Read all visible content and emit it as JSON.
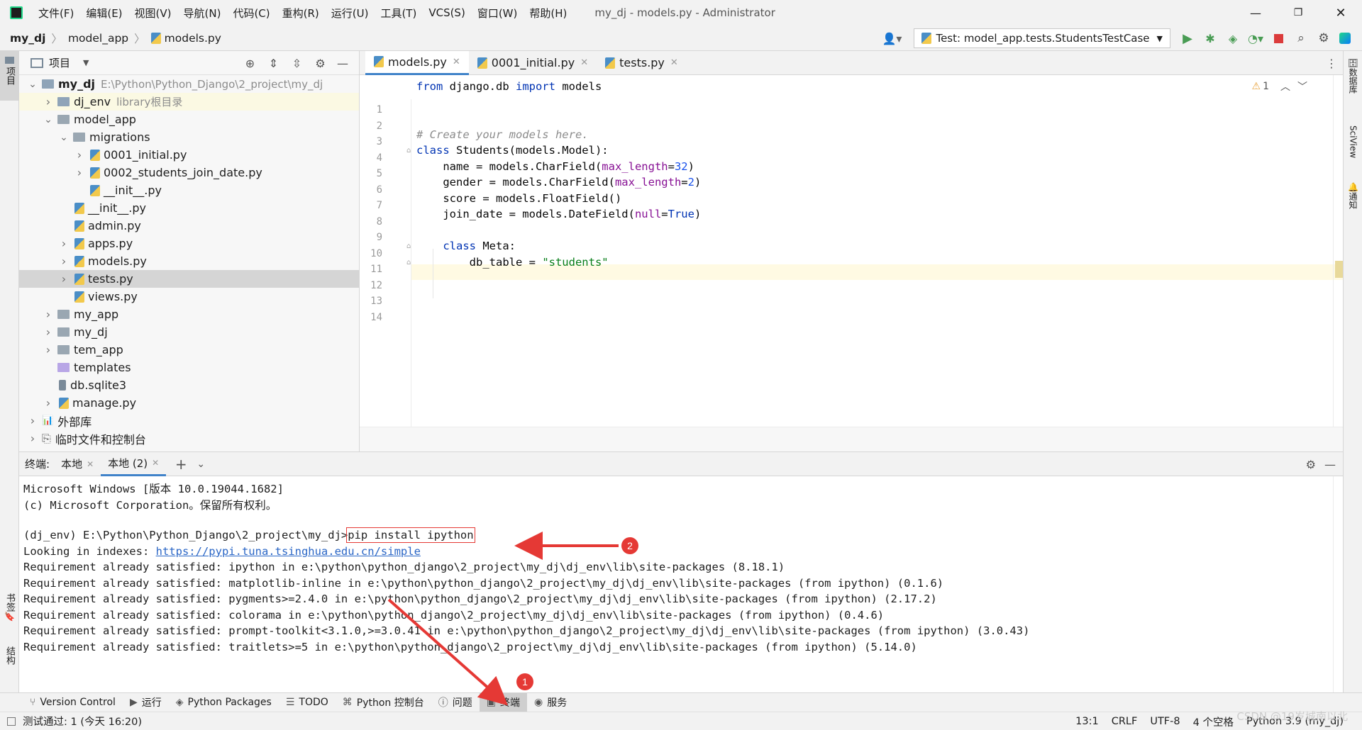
{
  "app": {
    "window_title": "my_dj - models.py - Administrator",
    "menu": [
      "文件(F)",
      "编辑(E)",
      "视图(V)",
      "导航(N)",
      "代码(C)",
      "重构(R)",
      "运行(U)",
      "工具(T)",
      "VCS(S)",
      "窗口(W)",
      "帮助(H)"
    ]
  },
  "breadcrumb": [
    "my_dj",
    "model_app",
    "models.py"
  ],
  "run_config": "Test: model_app.tests.StudentsTestCase",
  "project_panel": {
    "title": "项目",
    "tree": [
      {
        "name": "my_dj",
        "extra": "E:\\Python\\Python_Django\\2_project\\my_dj",
        "kind": "folder",
        "depth": 0,
        "open": true,
        "bold": true
      },
      {
        "name": "dj_env",
        "extra": "library根目录",
        "kind": "folder",
        "depth": 1,
        "open": false
      },
      {
        "name": "model_app",
        "extra": "",
        "kind": "pkg",
        "depth": 1,
        "open": true
      },
      {
        "name": "migrations",
        "extra": "",
        "kind": "pkg",
        "depth": 2,
        "open": true
      },
      {
        "name": "0001_initial.py",
        "extra": "",
        "kind": "py",
        "depth": 3,
        "open": false
      },
      {
        "name": "0002_students_join_date.py",
        "extra": "",
        "kind": "py",
        "depth": 3,
        "open": false
      },
      {
        "name": "__init__.py",
        "extra": "",
        "kind": "py",
        "depth": 3,
        "leaf": true
      },
      {
        "name": "__init__.py",
        "extra": "",
        "kind": "py",
        "depth": 2,
        "leaf": true
      },
      {
        "name": "admin.py",
        "extra": "",
        "kind": "py",
        "depth": 2,
        "leaf": true
      },
      {
        "name": "apps.py",
        "extra": "",
        "kind": "py",
        "depth": 2,
        "open": false
      },
      {
        "name": "models.py",
        "extra": "",
        "kind": "py",
        "depth": 2,
        "open": false
      },
      {
        "name": "tests.py",
        "extra": "",
        "kind": "py",
        "depth": 2,
        "open": false,
        "selected": true
      },
      {
        "name": "views.py",
        "extra": "",
        "kind": "py",
        "depth": 2,
        "leaf": true
      },
      {
        "name": "my_app",
        "extra": "",
        "kind": "pkg",
        "depth": 1,
        "open": false
      },
      {
        "name": "my_dj",
        "extra": "",
        "kind": "pkg",
        "depth": 1,
        "open": false
      },
      {
        "name": "tem_app",
        "extra": "",
        "kind": "pkg",
        "depth": 1,
        "open": false
      },
      {
        "name": "templates",
        "extra": "",
        "kind": "tpl",
        "depth": 1,
        "leaf": true
      },
      {
        "name": "db.sqlite3",
        "extra": "",
        "kind": "db",
        "depth": 1,
        "leaf": true
      },
      {
        "name": "manage.py",
        "extra": "",
        "kind": "py",
        "depth": 1,
        "open": false
      },
      {
        "name": "外部库",
        "extra": "",
        "kind": "lib",
        "depth": 0,
        "open": false
      },
      {
        "name": "临时文件和控制台",
        "extra": "",
        "kind": "scratch",
        "depth": 0,
        "open": false
      }
    ]
  },
  "editor": {
    "tabs": [
      {
        "label": "models.py",
        "active": true
      },
      {
        "label": "0001_initial.py",
        "active": false
      },
      {
        "label": "tests.py",
        "active": false
      }
    ],
    "warning_count": "1",
    "lines": [
      "1",
      "2",
      "3",
      "4",
      "5",
      "6",
      "7",
      "8",
      "9",
      "10",
      "11",
      "12",
      "13",
      "14"
    ],
    "code": {
      "l1_kw1": "from",
      "l1_mod": " django.db ",
      "l1_kw2": "import",
      "l1_name": " models",
      "l4_comment": "# Create your models here.",
      "l5_kw": "class",
      "l5_rest": " Students(models.Model):",
      "l6_a": "    name = models.CharField(",
      "l6_p": "max_length",
      "l6_eq": "=",
      "l6_n": "32",
      "l6_c": ")",
      "l7_a": "    gender = models.CharField(",
      "l7_p": "max_length",
      "l7_eq": "=",
      "l7_n": "2",
      "l7_c": ")",
      "l8": "    score = models.FloatField()",
      "l9_a": "    join_date = models.DateField(",
      "l9_p": "null",
      "l9_eq": "=",
      "l9_v": "True",
      "l9_c": ")",
      "l11_kw": "class",
      "l11_rest": " Meta:",
      "l12_a": "        db_table = ",
      "l12_s": "\"students\""
    }
  },
  "terminal": {
    "label": "终端:",
    "tabs": [
      "本地",
      "本地 (2)"
    ],
    "lines": {
      "l1": "Microsoft Windows [版本 10.0.19044.1682]",
      "l2": "(c) Microsoft Corporation。保留所有权利。",
      "prompt": "(dj_env) E:\\Python\\Python_Django\\2_project\\my_dj>",
      "command": "pip install ipython",
      "index_label": "Looking in indexes: ",
      "index_url": "https://pypi.tuna.tsinghua.edu.cn/simple",
      "r1": "Requirement already satisfied: ipython in e:\\python\\python_django\\2_project\\my_dj\\dj_env\\lib\\site-packages (8.18.1)",
      "r2": "Requirement already satisfied: matplotlib-inline in e:\\python\\python_django\\2_project\\my_dj\\dj_env\\lib\\site-packages (from ipython) (0.1.6)",
      "r3": "Requirement already satisfied: pygments>=2.4.0 in e:\\python\\python_django\\2_project\\my_dj\\dj_env\\lib\\site-packages (from ipython) (2.17.2)",
      "r4": "Requirement already satisfied: colorama in e:\\python\\python_django\\2_project\\my_dj\\dj_env\\lib\\site-packages (from ipython) (0.4.6)",
      "r5": "Requirement already satisfied: prompt-toolkit<3.1.0,>=3.0.41 in e:\\python\\python_django\\2_project\\my_dj\\dj_env\\lib\\site-packages (from ipython) (3.0.43)",
      "r6": "Requirement already satisfied: traitlets>=5 in e:\\python\\python_django\\2_project\\my_dj\\dj_env\\lib\\site-packages (from ipython) (5.14.0)"
    },
    "annotations": [
      "1",
      "2"
    ]
  },
  "bottom_tools": [
    "Version Control",
    "运行",
    "Python Packages",
    "TODO",
    "Python 控制台",
    "问题",
    "终端",
    "服务"
  ],
  "left_stripe": [
    "项目",
    "书签",
    "结构"
  ],
  "right_stripe": [
    "数据库",
    "SciView",
    "通知"
  ],
  "status": {
    "message": "测试通过: 1 (今天 16:20)",
    "position": "13:1",
    "line_sep": "CRLF",
    "encoding": "UTF-8",
    "indent": "4 个空格",
    "interpreter": "Python 3.9 (my_dj)",
    "watermark": "CSDN @19岁城南以北"
  },
  "colors": {
    "accent": "#4083c9",
    "annotation_red": "#e53935",
    "run_green": "#499c54",
    "stop_red": "#db3b3b"
  }
}
